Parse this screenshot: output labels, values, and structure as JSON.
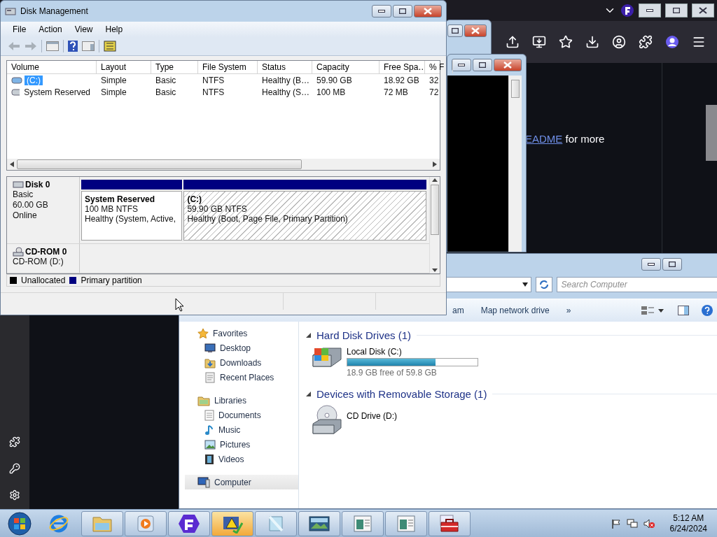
{
  "browser": {
    "link": "EADME",
    "text": "for more"
  },
  "disk_management": {
    "title": "Disk Management",
    "menu": [
      "File",
      "Action",
      "View",
      "Help"
    ],
    "columns": [
      "Volume",
      "Layout",
      "Type",
      "File System",
      "Status",
      "Capacity",
      "Free Spa…",
      "% F"
    ],
    "volumes": [
      {
        "cells": [
          "(C:)",
          "Simple",
          "Basic",
          "NTFS",
          "Healthy (B…",
          "59.90 GB",
          "18.92 GB",
          "32"
        ],
        "selected": true
      },
      {
        "cells": [
          "System Reserved",
          "Simple",
          "Basic",
          "NTFS",
          "Healthy (S…",
          "100 MB",
          "72 MB",
          "72"
        ],
        "selected": false
      }
    ],
    "disks": [
      {
        "name": "Disk 0",
        "kind": "disk",
        "details": [
          "Basic",
          "60.00 GB",
          "Online"
        ],
        "partitions": [
          {
            "name": "System Reserved",
            "size": "100 MB NTFS",
            "status": "Healthy (System, Active,",
            "selected": false
          },
          {
            "name": "(C:)",
            "size": "59.90 GB NTFS",
            "status": "Healthy (Boot, Page File, Primary Partition)",
            "selected": true
          }
        ]
      },
      {
        "name": "CD-ROM 0",
        "kind": "cdrom",
        "details": [
          "CD-ROM (D:)"
        ]
      }
    ],
    "legend": [
      {
        "label": "Unallocated",
        "color": "#000000"
      },
      {
        "label": "Primary partition",
        "color": "#000080"
      }
    ]
  },
  "explorer": {
    "search": {
      "placeholder": "Search Computer"
    },
    "commands": [
      "am",
      "Map network drive",
      "»"
    ],
    "nav": [
      {
        "label": "Favorites",
        "kind": "favorites",
        "selected": false,
        "children": [
          {
            "label": "Desktop",
            "kind": "desktop",
            "selected": false
          },
          {
            "label": "Downloads",
            "kind": "downloads",
            "selected": false
          },
          {
            "label": "Recent Places",
            "kind": "recent",
            "selected": false
          }
        ]
      },
      {
        "label": "Libraries",
        "kind": "libraries",
        "selected": false,
        "children": [
          {
            "label": "Documents",
            "kind": "documents",
            "selected": false
          },
          {
            "label": "Music",
            "kind": "music",
            "selected": false
          },
          {
            "label": "Pictures",
            "kind": "pictures",
            "selected": false
          },
          {
            "label": "Videos",
            "kind": "videos",
            "selected": false
          }
        ]
      },
      {
        "label": "Computer",
        "kind": "computer",
        "selected": true
      }
    ],
    "sections": [
      {
        "title": "Hard Disk Drives (1)",
        "items": [
          {
            "name": "Local Disk (C:)",
            "kind": "disk",
            "level": 0.68,
            "detail": "18.9 GB free of 59.8 GB"
          }
        ]
      },
      {
        "title": "Devices with Removable Storage (1)",
        "items": [
          {
            "name": "CD Drive (D:)",
            "kind": "cd"
          }
        ]
      }
    ]
  },
  "taskbar": {
    "buttons": [
      {
        "kind": "ie",
        "running": false,
        "selected": false
      },
      {
        "kind": "folder",
        "running": true,
        "selected": false
      },
      {
        "kind": "media",
        "running": true,
        "selected": false
      },
      {
        "kind": "fapp",
        "running": true,
        "selected": false
      },
      {
        "kind": "warning",
        "running": true,
        "selected": true
      },
      {
        "kind": "notepad",
        "running": true,
        "selected": false
      },
      {
        "kind": "picture",
        "running": true,
        "selected": false
      },
      {
        "kind": "window",
        "running": true,
        "selected": false
      },
      {
        "kind": "window",
        "running": true,
        "selected": false
      },
      {
        "kind": "toolbox",
        "running": true,
        "selected": false
      }
    ],
    "time": "5:12 AM",
    "date": "6/24/2024"
  }
}
